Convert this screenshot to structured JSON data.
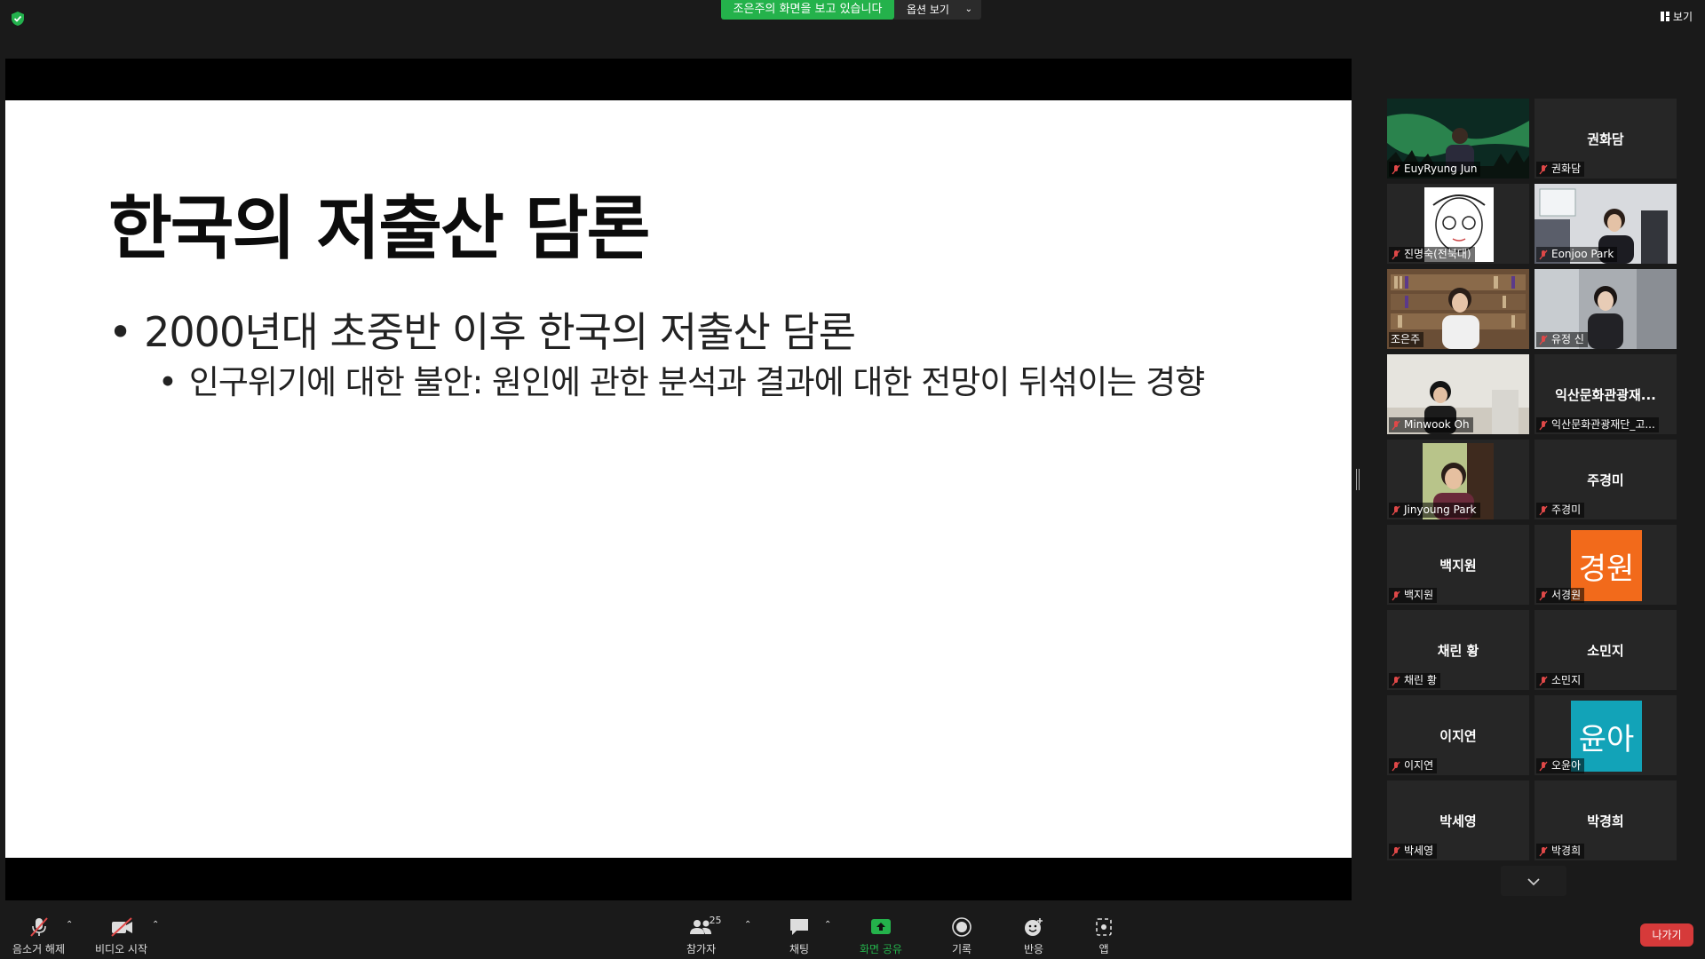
{
  "top": {
    "share_banner": "조은주의 화면을 보고 있습니다",
    "view_options": "옵션 보기",
    "view_label": "보기"
  },
  "slide": {
    "title": "한국의 저출산 담론",
    "bullet1": "2000년대 초중반 이후 한국의 저출산 담론",
    "bullet2": "인구위기에 대한 불안: 원인에 관한 분석과 결과에 대한 전망이 뒤섞이는 경향"
  },
  "gallery": {
    "tiles": [
      {
        "name": "EuyRyung Jun",
        "center": ""
      },
      {
        "name": "권화담",
        "center": "권화담"
      },
      {
        "name": "진명숙(전북대)",
        "center": ""
      },
      {
        "name": "Eonjoo Park",
        "center": ""
      },
      {
        "name": "조은주",
        "center": ""
      },
      {
        "name": "유정 신",
        "center": ""
      },
      {
        "name": "Minwook Oh",
        "center": ""
      },
      {
        "name": "익산문화관광재단_고...",
        "center": "익산문화관광재..."
      },
      {
        "name": "Jinyoung Park",
        "center": ""
      },
      {
        "name": "주경미",
        "center": "주경미"
      },
      {
        "name": "백지원",
        "center": "백지원"
      },
      {
        "name": "서경원",
        "center": "",
        "avatar": "경원",
        "avatar_color": "#f26a1b"
      },
      {
        "name": "채린 황",
        "center": "채린 황"
      },
      {
        "name": "소민지",
        "center": "소민지"
      },
      {
        "name": "이지연",
        "center": "이지연"
      },
      {
        "name": "오윤아",
        "center": "",
        "avatar": "윤아",
        "avatar_color": "#12a3b8"
      },
      {
        "name": "박세영",
        "center": "박세영"
      },
      {
        "name": "박경희",
        "center": "박경희"
      }
    ]
  },
  "toolbar": {
    "mute_label": "음소거 해제",
    "video_label": "비디오 시작",
    "participants_label": "참가자",
    "participants_count": "25",
    "chat_label": "채팅",
    "share_label": "화면 공유",
    "record_label": "기록",
    "reactions_label": "반응",
    "apps_label": "앱",
    "leave_label": "나가기"
  },
  "colors": {
    "share_green": "#24b24b",
    "leave_red": "#d63a3a",
    "active_speaker": "#c5e04a"
  }
}
